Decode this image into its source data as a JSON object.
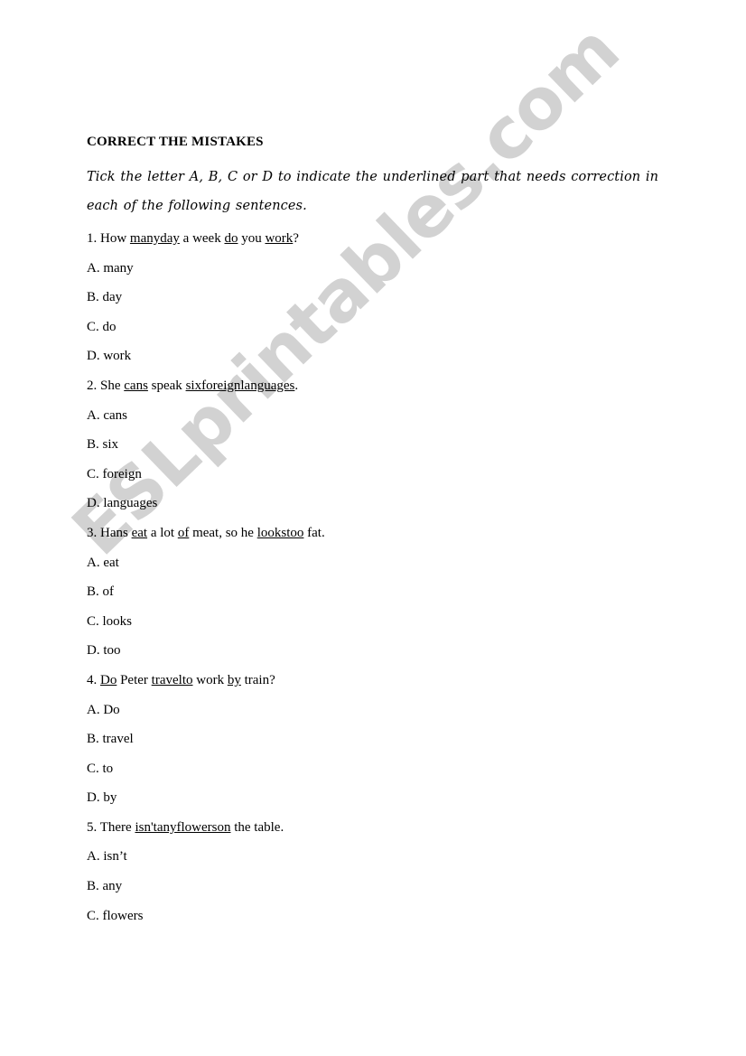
{
  "document": {
    "title": "CORRECT THE MISTAKES",
    "instructions": "Tick the letter A, B, C or D to indicate the underlined part that needs correction in each of the following sentences.",
    "watermark": "ESLprintables.com",
    "watermark_color": "#d2d2d2",
    "background_color": "#ffffff",
    "text_color": "#000000",
    "questions": [
      {
        "number": "1.",
        "prompt_parts": [
          {
            "text": "1. How ",
            "underlined": false
          },
          {
            "text": "manyday",
            "underlined": true
          },
          {
            "text": " a week ",
            "underlined": false
          },
          {
            "text": "do",
            "underlined": true
          },
          {
            "text": " you ",
            "underlined": false
          },
          {
            "text": "work",
            "underlined": true
          },
          {
            "text": "?",
            "underlined": false
          }
        ],
        "options": [
          {
            "label": "A.",
            "text": "A. many"
          },
          {
            "label": "B.",
            "text": "B. day"
          },
          {
            "label": "C.",
            "text": "C. do"
          },
          {
            "label": "D.",
            "text": "D. work"
          }
        ]
      },
      {
        "number": "2.",
        "prompt_parts": [
          {
            "text": "2. She ",
            "underlined": false
          },
          {
            "text": "cans",
            "underlined": true
          },
          {
            "text": " speak ",
            "underlined": false
          },
          {
            "text": "sixforeignlanguages",
            "underlined": true
          },
          {
            "text": ".",
            "underlined": false
          }
        ],
        "options": [
          {
            "label": "A.",
            "text": "A. cans"
          },
          {
            "label": "B.",
            "text": "B. six"
          },
          {
            "label": "C.",
            "text": "C. foreign"
          },
          {
            "label": "D.",
            "text": "D. languages"
          }
        ]
      },
      {
        "number": "3.",
        "prompt_parts": [
          {
            "text": "3. Hans ",
            "underlined": false
          },
          {
            "text": "eat",
            "underlined": true
          },
          {
            "text": " a lot ",
            "underlined": false
          },
          {
            "text": "of",
            "underlined": true
          },
          {
            "text": " meat, so he ",
            "underlined": false
          },
          {
            "text": "lookstoo",
            "underlined": true
          },
          {
            "text": " fat.",
            "underlined": false
          }
        ],
        "options": [
          {
            "label": "A.",
            "text": "A. eat"
          },
          {
            "label": "B.",
            "text": "B. of"
          },
          {
            "label": "C.",
            "text": "C. looks"
          },
          {
            "label": "D.",
            "text": "D. too"
          }
        ]
      },
      {
        "number": "4.",
        "prompt_parts": [
          {
            "text": "4. ",
            "underlined": false
          },
          {
            "text": "Do",
            "underlined": true
          },
          {
            "text": " Peter ",
            "underlined": false
          },
          {
            "text": "travelto",
            "underlined": true
          },
          {
            "text": " work ",
            "underlined": false
          },
          {
            "text": "by",
            "underlined": true
          },
          {
            "text": " train?",
            "underlined": false
          }
        ],
        "options": [
          {
            "label": "A.",
            "text": "A. Do"
          },
          {
            "label": "B.",
            "text": "B. travel"
          },
          {
            "label": "C.",
            "text": "C. to"
          },
          {
            "label": "D.",
            "text": "D. by"
          }
        ]
      },
      {
        "number": "5.",
        "prompt_parts": [
          {
            "text": "5. There ",
            "underlined": false
          },
          {
            "text": "isn'tanyflowerson",
            "underlined": true
          },
          {
            "text": " the table.",
            "underlined": false
          }
        ],
        "options": [
          {
            "label": "A.",
            "text": "A. isn’t"
          },
          {
            "label": "B.",
            "text": "B. any"
          },
          {
            "label": "C.",
            "text": "C. flowers"
          }
        ]
      }
    ]
  }
}
